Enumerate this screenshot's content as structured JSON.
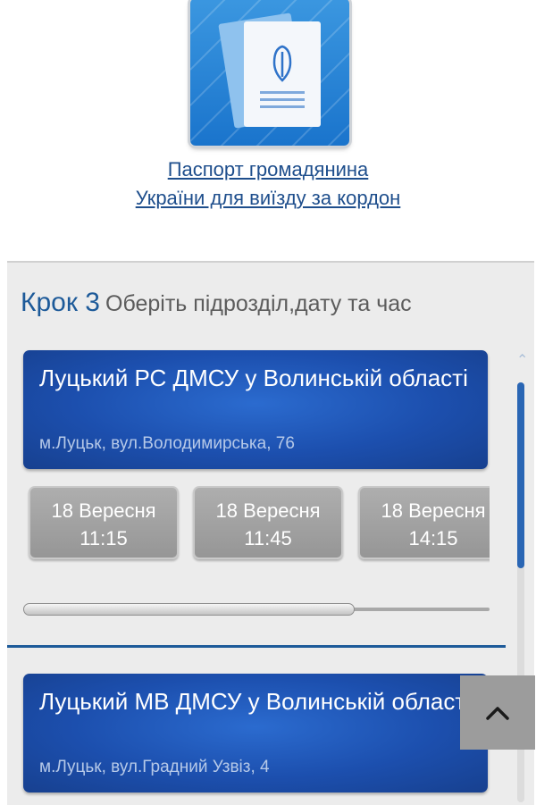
{
  "service": {
    "icon": "passport-icon",
    "link_line1": "Паспорт громадянина",
    "link_line2": "України для виїзду за кордон"
  },
  "step": {
    "number": "Крок 3",
    "description": "Оберіть підрозділ,дату та час"
  },
  "offices": [
    {
      "name": "Луцький РС ДМСУ у Волинській області",
      "address": "м.Луцьк, вул.Володимирська, 76",
      "slots": [
        {
          "date": "18 Вересня",
          "time": "11:15"
        },
        {
          "date": "18 Вересня",
          "time": "11:45"
        },
        {
          "date": "18 Вересня",
          "time": "14:15"
        }
      ],
      "slot_scroll_fraction": 0.71
    },
    {
      "name": "Луцький МВ ДМСУ у Волинській області",
      "address": "м.Луцьк, вул.Градний Узвіз, 4"
    }
  ],
  "page_scroll_fraction": 0.44,
  "colors": {
    "accent": "#1d5a99",
    "card": "#1c4fae",
    "slot": "#a3a3a3"
  },
  "icons": {
    "scroll_up": "chevron-up-icon",
    "scroll_to_top": "chevron-up-icon"
  }
}
